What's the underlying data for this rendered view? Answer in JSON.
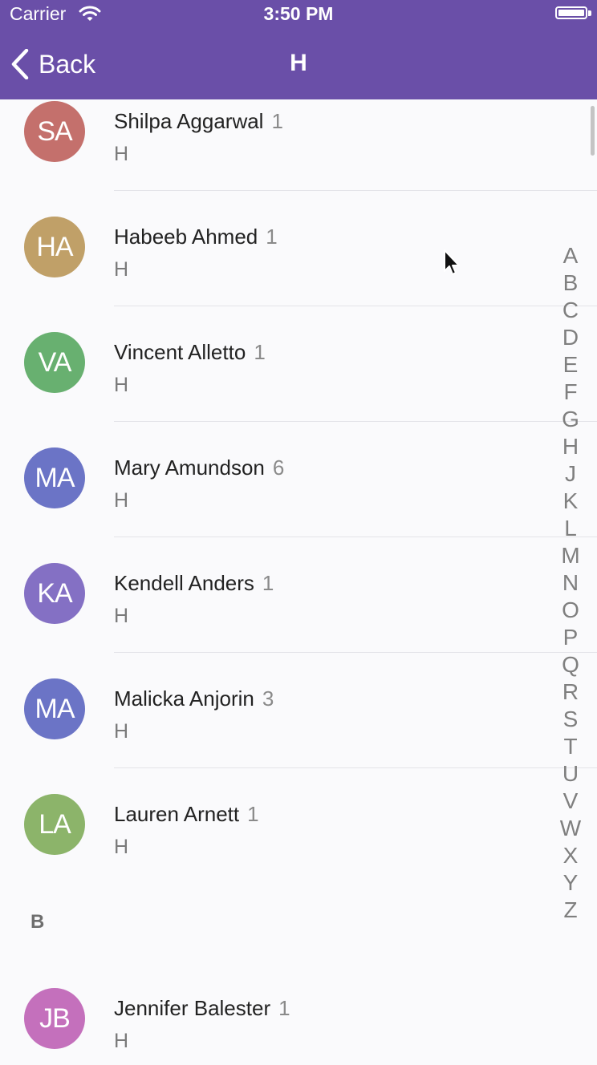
{
  "status_bar": {
    "carrier": "Carrier",
    "time": "3:50 PM",
    "battery_level": 1.0
  },
  "nav": {
    "back_label": "Back",
    "title": "H"
  },
  "contacts_section_a": [
    {
      "initials": "SA",
      "name": "Shilpa Aggarwal",
      "count": "1",
      "subtitle": "H",
      "color": "#c4706c"
    },
    {
      "initials": "HA",
      "name": "Habeeb Ahmed",
      "count": "1",
      "subtitle": "H",
      "color": "#c0a068"
    },
    {
      "initials": "VA",
      "name": "Vincent Alletto",
      "count": "1",
      "subtitle": "H",
      "color": "#68b070"
    },
    {
      "initials": "MA",
      "name": "Mary Amundson",
      "count": "6",
      "subtitle": "H",
      "color": "#6b74c6"
    },
    {
      "initials": "KA",
      "name": "Kendell Anders",
      "count": "1",
      "subtitle": "H",
      "color": "#8470c4"
    },
    {
      "initials": "MA",
      "name": "Malicka Anjorin",
      "count": "3",
      "subtitle": "H",
      "color": "#6b74c6"
    },
    {
      "initials": "LA",
      "name": "Lauren Arnett",
      "count": "1",
      "subtitle": "H",
      "color": "#8cb46a"
    }
  ],
  "section_b": {
    "header": "B",
    "contacts": [
      {
        "initials": "JB",
        "name": "Jennifer Balester",
        "count": "1",
        "subtitle": "H",
        "color": "#c470bc"
      }
    ]
  },
  "index_letters": [
    "A",
    "B",
    "C",
    "D",
    "E",
    "F",
    "G",
    "H",
    "J",
    "K",
    "L",
    "M",
    "N",
    "O",
    "P",
    "Q",
    "R",
    "S",
    "T",
    "U",
    "V",
    "W",
    "X",
    "Y",
    "Z"
  ],
  "icons": {
    "back": "chevron-left-icon",
    "wifi": "wifi-icon",
    "battery": "battery-icon",
    "cursor": "mouse-pointer-icon"
  }
}
